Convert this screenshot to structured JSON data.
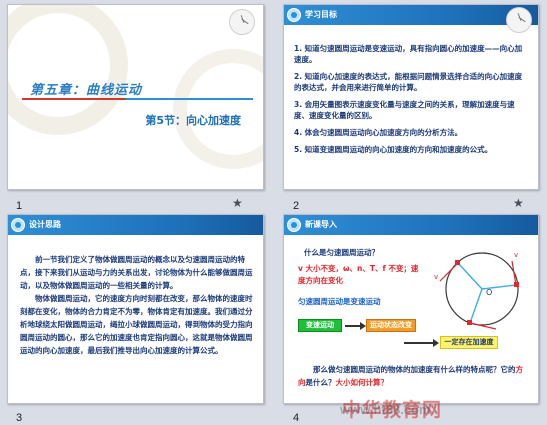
{
  "slides": [
    {
      "number": "1",
      "chapter": "第五章：曲线运动",
      "section": "第5节：向心加速度"
    },
    {
      "number": "2",
      "header": "学习目标",
      "goals": [
        "1. 知道匀速圆周运动是变速运动，具有指向圆心的加速度——向心加速度。",
        "2. 知道向心加速度的表达式，能根据问题情景选择合适的向心加速度的表达式，并会用来进行简单的计算。",
        "3. 会用矢量图表示速度变化量与速度之间的关系，理解加速度与速度、速度变化量的区别。",
        "4. 体会匀速圆周运动向心加速度方向的分析方法。",
        "5. 知道变速圆周运动的向心加速度的方向和加速度的公式。"
      ]
    },
    {
      "number": "3",
      "header": "设计思路",
      "paragraphs": [
        "前一节我们定义了物体做圆周运动的概念以及匀速圆周运动的特点，接下来我们从运动与力的关系出发，讨论物体为什么能够做圆周运动，以及物体做圆周运动的一些相关量的计算。",
        "物体做圆周运动，它的速度方向时刻都在改变，那么物体的速度时刻都在变化，物体的合力肯定不为零，物体肯定有加速度。我们通过分析地球绕太阳做圆周运动，绳拉小球做圆周运动，得到物体的受力指向圆周运动的圆心，那么它的加速度也肯定指向圆心，这就是物体做圆周运动的向心加速度，最后我们推导出向心加速度的计算公式。"
      ]
    },
    {
      "number": "4",
      "header": "新课导入",
      "question": "什么是匀速圆周运动？",
      "red_text": "v 大小不变，ω、n、T、f 不变；速度方向在变化",
      "blue_text": "匀速圆周运动是变速运动",
      "box_green": "变速运动",
      "box_orange": "运动状态改变",
      "box_yellow": "一定存在加速度",
      "bottom_text_a": "那么做匀速圆周运动的物体的加速度有什么样的特点呢？它的",
      "bottom_text_hl": "方向",
      "bottom_text_b": "是什么？",
      "bottom_text_c": "大小如何计算？",
      "circle_labels": {
        "center": "O",
        "v": "v"
      }
    }
  ],
  "watermark": "中华教育网",
  "watermark_url": "www.ht88.com",
  "colors": {
    "header_blue": "#1d6fb8",
    "text_navy": "#1d3b7a",
    "accent_red": "#e4262c",
    "green_box": "#1fbf3a",
    "orange_box": "#f29b26",
    "yellow_box": "#fff26b"
  },
  "icons": [
    "star-icon",
    "app-logo-icon",
    "clock-decoration-icon"
  ]
}
